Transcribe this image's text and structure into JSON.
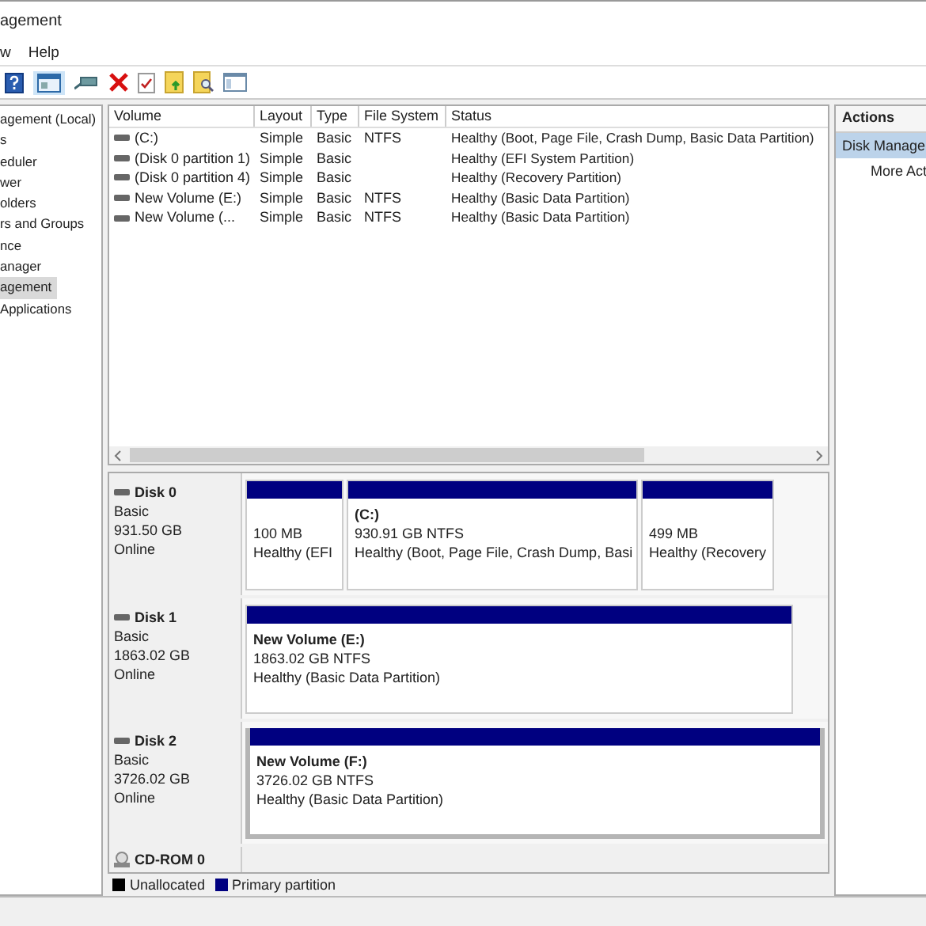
{
  "window": {
    "title": "agement"
  },
  "menu": [
    {
      "label": "w"
    },
    {
      "label": "Help"
    }
  ],
  "tree": [
    {
      "label": "agement (Local)",
      "selected": false
    },
    {
      "label": "s",
      "selected": false
    },
    {
      "label": "eduler",
      "selected": false
    },
    {
      "label": "wer",
      "selected": false
    },
    {
      "label": "olders",
      "selected": false
    },
    {
      "label": "rs and Groups",
      "selected": false
    },
    {
      "label": "nce",
      "selected": false
    },
    {
      "label": "anager",
      "selected": false
    },
    {
      "label": "agement",
      "selected": true
    },
    {
      "label": "Applications",
      "selected": false
    }
  ],
  "volumes": {
    "columns": [
      "Volume",
      "Layout",
      "Type",
      "File System",
      "Status"
    ],
    "rows": [
      [
        "(C:)",
        "Simple",
        "Basic",
        "NTFS",
        "Healthy (Boot, Page File, Crash Dump, Basic Data Partition)"
      ],
      [
        "(Disk 0 partition 1)",
        "Simple",
        "Basic",
        "",
        "Healthy (EFI System Partition)"
      ],
      [
        "(Disk 0 partition 4)",
        "Simple",
        "Basic",
        "",
        "Healthy (Recovery Partition)"
      ],
      [
        "New Volume (E:)",
        "Simple",
        "Basic",
        "NTFS",
        "Healthy (Basic Data Partition)"
      ],
      [
        "New Volume (...",
        "Simple",
        "Basic",
        "NTFS",
        "Healthy (Basic Data Partition)"
      ]
    ]
  },
  "disks": [
    {
      "name": "Disk 0",
      "kind": "disk",
      "type": "Basic",
      "size": "931.50 GB",
      "state": "Online",
      "partitions": [
        {
          "detail": "100 MB",
          "status": "Healthy (EFI",
          "selected": false
        },
        {
          "label": "(C:)",
          "detail": "930.91 GB NTFS",
          "status": "Healthy (Boot, Page File, Crash Dump, Basi",
          "selected": false
        },
        {
          "detail": "499 MB",
          "status": "Healthy (Recovery",
          "selected": false
        }
      ]
    },
    {
      "name": "Disk 1",
      "kind": "disk",
      "type": "Basic",
      "size": "1863.02 GB",
      "state": "Online",
      "partitions": [
        {
          "label": "New Volume  (E:)",
          "detail": "1863.02 GB NTFS",
          "status": "Healthy (Basic Data Partition)",
          "selected": false
        }
      ]
    },
    {
      "name": "Disk 2",
      "kind": "disk",
      "type": "Basic",
      "size": "3726.02 GB",
      "state": "Online",
      "partitions": [
        {
          "label": "New Volume  (F:)",
          "detail": "3726.02 GB NTFS",
          "status": "Healthy (Basic Data Partition)",
          "selected": true
        }
      ]
    },
    {
      "name": "CD-ROM 0",
      "kind": "cdrom"
    }
  ],
  "legend": [
    {
      "label": "Unallocated",
      "color": "#000000"
    },
    {
      "label": "Primary partition",
      "color": "#000080"
    }
  ],
  "actions": {
    "title": "Actions",
    "items": [
      {
        "label": "Disk Manage",
        "selected": true
      },
      {
        "label": "More Act",
        "selected": false
      }
    ]
  }
}
